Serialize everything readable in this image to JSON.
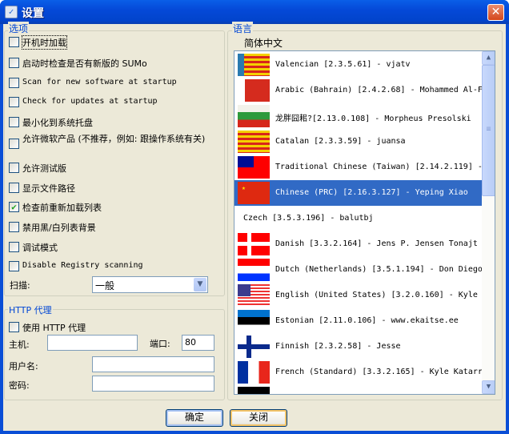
{
  "window": {
    "title": "设置",
    "app_icon": "settings-checkbox-icon",
    "close_icon": "close-icon"
  },
  "options": {
    "group_label": "选项",
    "checkboxes": [
      {
        "label": "开机时加载",
        "checked": false,
        "cjk": true
      },
      {
        "label": "启动时检查是否有新版的 SUMo",
        "checked": false,
        "cjk": true
      },
      {
        "label": "Scan for new software at startup",
        "checked": false,
        "cjk": false
      },
      {
        "label": "Check for updates at startup",
        "checked": false,
        "cjk": false
      },
      {
        "label": "最小化到系统托盘",
        "checked": false,
        "cjk": true
      },
      {
        "label": "允许微软产品 (不推荐，例如: 跟操作系统有关)",
        "checked": false,
        "cjk": true
      },
      {
        "label": "允许测试版",
        "checked": false,
        "cjk": true
      },
      {
        "label": "显示文件路径",
        "checked": false,
        "cjk": true
      },
      {
        "label": "检查前重新加载列表",
        "checked": true,
        "cjk": true
      },
      {
        "label": "禁用黑/白列表背景",
        "checked": false,
        "cjk": true
      },
      {
        "label": "调试模式",
        "checked": false,
        "cjk": true
      },
      {
        "label": "Disable Registry scanning",
        "checked": false,
        "cjk": false
      }
    ],
    "scan_label": "扫描:",
    "scan_value": "一般"
  },
  "proxy": {
    "group_label": "HTTP 代理",
    "use_proxy_label": "使用 HTTP 代理",
    "use_proxy_checked": false,
    "host_label": "主机:",
    "host_value": "",
    "port_label": "端口:",
    "port_value": "80",
    "username_label": "用户名:",
    "username_value": "",
    "password_label": "密码:",
    "password_value": ""
  },
  "language": {
    "group_label": "语言",
    "current": "简体中文",
    "scroll_fraction": 0.0,
    "items": [
      {
        "flag": "valencia",
        "text": "Valencian [2.3.5.61] - vjatv"
      },
      {
        "flag": "bahrain",
        "text": "Arabic (Bahrain) [2.4.2.68] - Mohammed Al-F"
      },
      {
        "flag": "bulgaria",
        "text": "龙胖囧耜?[2.13.0.108] - Morpheus Presolski"
      },
      {
        "flag": "catalonia",
        "text": "Catalan [2.3.3.59] - juansa"
      },
      {
        "flag": "taiwan",
        "text": "Traditional Chinese (Taiwan) [2.14.2.119] -"
      },
      {
        "flag": "china",
        "text": "Chinese (PRC) [2.16.3.127] - Yeping Xiao",
        "selected": true
      },
      {
        "flag": "none",
        "text": "Czech [3.5.3.196] - balutbj"
      },
      {
        "flag": "denmark",
        "text": "Danish [3.3.2.164] - Jens P. Jensen Tonajt"
      },
      {
        "flag": "netherlands",
        "text": "Dutch (Netherlands) [3.5.1.194] - Don Diego"
      },
      {
        "flag": "usa",
        "text": "English (United States) [3.2.0.160] - Kyle"
      },
      {
        "flag": "estonia",
        "text": "Estonian [2.11.0.106] - www.ekaitse.ee"
      },
      {
        "flag": "finland",
        "text": "Finnish [2.3.2.58] - Jesse"
      },
      {
        "flag": "france",
        "text": "French (Standard) [3.3.2.165] - Kyle Katarr"
      },
      {
        "flag": "germany",
        "text": ""
      }
    ]
  },
  "buttons": {
    "ok": "确定",
    "close": "关闭"
  }
}
